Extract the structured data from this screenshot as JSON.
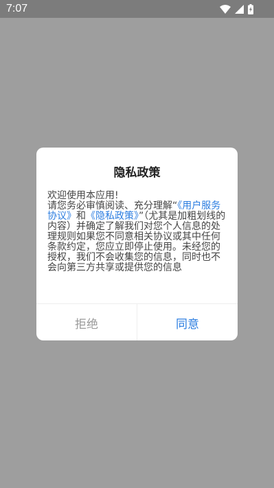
{
  "status_bar": {
    "time": "7:07",
    "icons": [
      "wifi-icon",
      "cell-signal-icon",
      "battery-charging-icon"
    ]
  },
  "dialog": {
    "title": "隐私政策",
    "body": {
      "greeting": "欢迎使用本应用!",
      "intro": "请您务必审慎阅读、充分理解“",
      "terms_link": "《用户服务协议》",
      "conjunction": "和",
      "privacy_link": "《隐私政策》",
      "rest": "”（尤其是加粗划线的内容）并确定了解我们对您个人信息的处理规则如果您不同意相关协议或其中任何条款约定，您应立即停止使用。未经您的授权，我们不会收集您的信息，同时也不会向第三方共享或提供您的信息"
    },
    "reject_label": "拒绝",
    "agree_label": "同意"
  },
  "colors": {
    "link": "#2b7de0",
    "scrim": "#9e9e9e",
    "status_bar": "#7c7c7c"
  }
}
